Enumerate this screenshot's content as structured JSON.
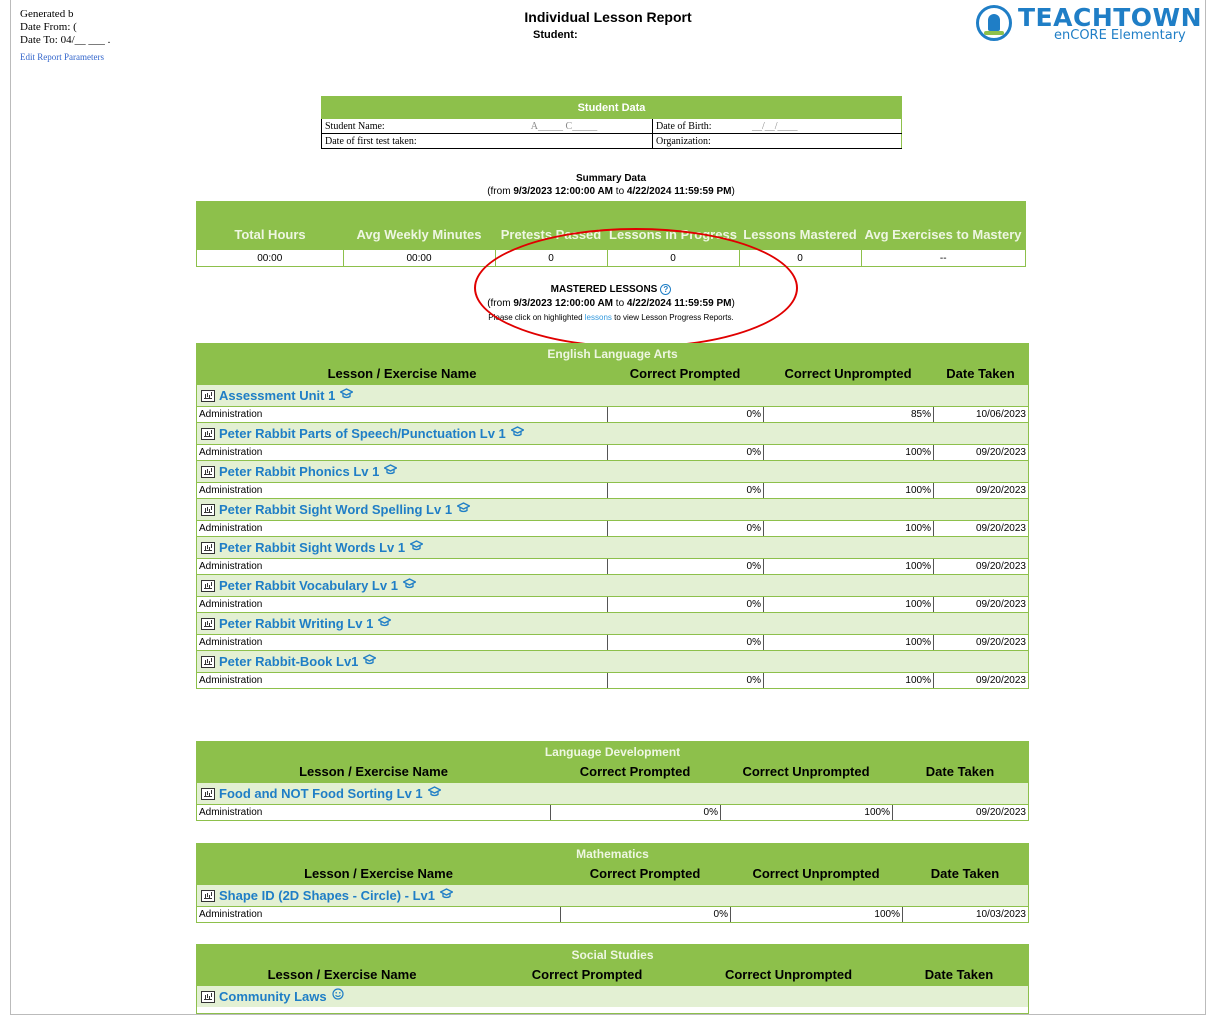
{
  "header": {
    "generated": "Generated b",
    "date_from": "Date From: (",
    "date_to": "Date To: 04/__ ___ .",
    "edit_link": "Edit Report Parameters",
    "title": "Individual Lesson Report",
    "student_label": "Student:"
  },
  "logo": {
    "brand": "TEACHTOWN",
    "sub": "enCORE Elementary"
  },
  "student_data": {
    "title": "Student Data",
    "name_label": "Student Name:",
    "name_value": "A_____ C_____",
    "dob_label": "Date of Birth:",
    "dob_value": "__/__/____",
    "first_test_label": "Date of first test taken:",
    "org_label": "Organization:"
  },
  "summary": {
    "title": "Summary Data",
    "range_prefix": "(from ",
    "range_from": "9/3/2023 12:00:00 AM",
    "range_mid": " to ",
    "range_to": "4/22/2024 11:59:59 PM",
    "range_suffix": ")",
    "columns": [
      "Total Hours",
      "Avg Weekly Minutes",
      "Pretests Passed",
      "Lessons in Progress",
      "Lessons Mastered",
      "Avg Exercises to Mastery"
    ],
    "values": [
      "00:00",
      "00:00",
      "0",
      "0",
      "0",
      "--"
    ]
  },
  "mastered": {
    "title": "MASTERED LESSONS",
    "help_icon": "?",
    "range_prefix": "(from ",
    "range_from": "9/3/2023 12:00:00 AM",
    "range_mid": " to ",
    "range_to": "4/22/2024 11:59:59 PM",
    "range_suffix": ")",
    "note_before": "Please click on highlighted ",
    "note_link": "lessons",
    "note_after": " to view Lesson Progress Reports."
  },
  "cols": {
    "name": "Lesson / Exercise Name",
    "prompted": "Correct Prompted",
    "unprompted": "Correct Unprompted",
    "date": "Date Taken"
  },
  "sections": [
    {
      "title": "English Language Arts",
      "lessons": [
        {
          "name": "Assessment Unit 1",
          "icon": "graduation-cap-icon",
          "row": [
            "Administration",
            "0%",
            "85%",
            "10/06/2023"
          ]
        },
        {
          "name": "Peter Rabbit Parts of Speech/Punctuation Lv 1",
          "icon": "graduation-cap-icon",
          "row": [
            "Administration",
            "0%",
            "100%",
            "09/20/2023"
          ]
        },
        {
          "name": "Peter Rabbit Phonics Lv 1",
          "icon": "graduation-cap-icon",
          "row": [
            "Administration",
            "0%",
            "100%",
            "09/20/2023"
          ]
        },
        {
          "name": "Peter Rabbit Sight Word Spelling Lv 1",
          "icon": "graduation-cap-icon",
          "row": [
            "Administration",
            "0%",
            "100%",
            "09/20/2023"
          ]
        },
        {
          "name": "Peter Rabbit Sight Words Lv 1",
          "icon": "graduation-cap-icon",
          "row": [
            "Administration",
            "0%",
            "100%",
            "09/20/2023"
          ]
        },
        {
          "name": "Peter Rabbit Vocabulary Lv 1",
          "icon": "graduation-cap-icon",
          "row": [
            "Administration",
            "0%",
            "100%",
            "09/20/2023"
          ]
        },
        {
          "name": "Peter Rabbit Writing Lv 1",
          "icon": "graduation-cap-icon",
          "row": [
            "Administration",
            "0%",
            "100%",
            "09/20/2023"
          ]
        },
        {
          "name": "Peter Rabbit-Book Lv1",
          "icon": "graduation-cap-icon",
          "row": [
            "Administration",
            "0%",
            "100%",
            "09/20/2023"
          ]
        }
      ]
    },
    {
      "title": "Language Development",
      "lessons": [
        {
          "name": "Food and NOT Food Sorting Lv 1",
          "icon": "graduation-cap-icon",
          "row": [
            "Administration",
            "0%",
            "100%",
            "09/20/2023"
          ]
        }
      ]
    },
    {
      "title": "Mathematics",
      "lessons": [
        {
          "name": "Shape ID (2D Shapes - Circle) - Lv1",
          "icon": "graduation-cap-icon",
          "row": [
            "Administration",
            "0%",
            "100%",
            "10/03/2023"
          ]
        }
      ]
    },
    {
      "title": "Social Studies",
      "lessons": [
        {
          "name": "Community Laws",
          "icon": "smiley-icon"
        }
      ]
    }
  ],
  "colors": {
    "green": "#8dc04b",
    "light_green": "#e3f0d3",
    "link_blue": "#1f7ec6",
    "annotation_red": "#e00000"
  }
}
